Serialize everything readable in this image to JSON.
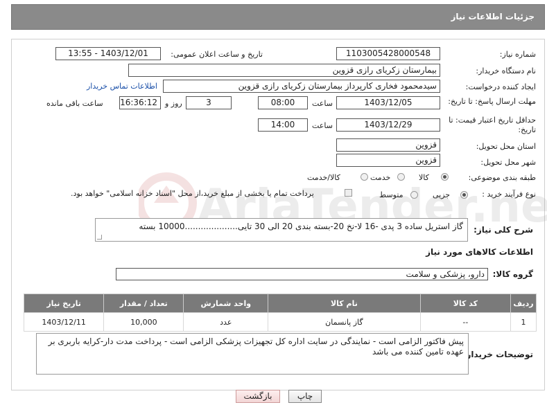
{
  "header": {
    "title": "جزئیات اطلاعات نیاز"
  },
  "fields": {
    "need_number_label": "شماره نیاز:",
    "need_number": "1103005428000548",
    "announce_label": "تاریخ و ساعت اعلان عمومی:",
    "announce_value": "1403/12/01 - 13:55",
    "buyer_org_label": "نام دستگاه خریدار:",
    "buyer_org": "بیمارستان زکریای رازی قزوین",
    "requester_label": "ایجاد کننده درخواست:",
    "requester": "سیدمحمود فخاری کارپرداز بیمارستان زکریای رازی قزوین",
    "contact_link": "اطلاعات تماس خریدار",
    "deadline_label": "مهلت ارسال پاسخ: تا تاریخ:",
    "deadline_date": "1403/12/05",
    "time_label": "ساعت",
    "deadline_time": "08:00",
    "days_value": "3",
    "days_label": "روز و",
    "remaining_time": "16:36:12",
    "remaining_label": "ساعت باقی مانده",
    "validity_label": "حداقل تاریخ اعتبار قیمت: تا تاریخ:",
    "validity_date": "1403/12/29",
    "validity_time_label": "ساعت",
    "validity_time": "14:00",
    "province_label": "استان محل تحویل:",
    "province": "قزوین",
    "city_label": "شهر محل تحویل:",
    "city": "قزوین",
    "category_label": "طبقه بندی موضوعی:",
    "category_options": [
      "کالا",
      "خدمت",
      "کالا/خدمت"
    ],
    "category_selected": "کالا",
    "process_label": "نوع فرآیند خرید :",
    "process_options": [
      "جزیی",
      "متوسط"
    ],
    "process_selected": "جزیی",
    "payment_note": "پرداخت تمام یا بخشی از مبلغ خرید،از محل \"اسناد خزانه اسلامی\" خواهد بود."
  },
  "description": {
    "label": "شرح کلی نیاز:",
    "value": "گاز استریل ساده 3 پدی -16 لا-نخ 20-بسته بندی 20 الی 30 تایی....................10000 بسته"
  },
  "goods_section": {
    "title": "اطلاعات کالاهای مورد نیاز",
    "group_label": "گروه کالا:",
    "group_value": "دارو، پزشکی و سلامت"
  },
  "table": {
    "headers": [
      "ردیف",
      "کد کالا",
      "نام کالا",
      "واحد شمارش",
      "تعداد / مقدار",
      "تاریخ نیاز"
    ],
    "rows": [
      [
        "1",
        "--",
        "گاز پانسمان",
        "عدد",
        "10,000",
        "1403/12/11"
      ]
    ]
  },
  "buyer_notes": {
    "label": "توضیحات خریدار:",
    "value": "پیش فاکتور الزامی است - نمایندگی در سایت اداره کل تجهیزات پزشکی الزامی است - پرداخت مدت دار-کرایه باربری بر عهده تامین کننده می باشد"
  },
  "buttons": {
    "print": "چاپ",
    "back": "بازگشت"
  },
  "watermark": {
    "text": "AriaTender.neT"
  },
  "colors": {
    "header_bg": "#8a8a8a",
    "table_header_bg": "#7a7a7a",
    "link": "#1a4fa8",
    "back_button": "#f3d6d6"
  }
}
